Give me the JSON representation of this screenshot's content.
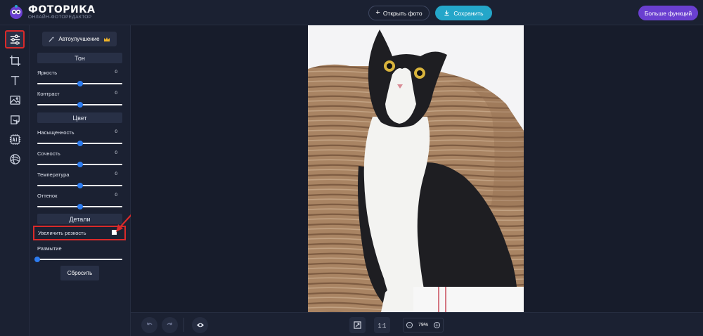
{
  "header": {
    "brand_title": "ФОТОРИКА",
    "brand_subtitle": "ОНЛАЙН-ФОТОРЕДАКТОР",
    "open_photo_label": "Открыть фото",
    "save_label": "Сохранить",
    "more_features_label": "Больше функций"
  },
  "tool_rail": {
    "items": [
      {
        "icon": "sliders-icon",
        "active": true
      },
      {
        "icon": "crop-icon"
      },
      {
        "icon": "text-icon"
      },
      {
        "icon": "image-icon"
      },
      {
        "icon": "sticker-icon"
      },
      {
        "icon": "ai-icon"
      },
      {
        "icon": "palette-icon"
      }
    ]
  },
  "panel": {
    "auto_enhance_label": "Автоулучшение",
    "sections": {
      "tone": "Тон",
      "color": "Цвет",
      "details": "Детали"
    },
    "sliders": {
      "brightness": {
        "label": "Яркость",
        "value": "0",
        "level": 0.5
      },
      "contrast": {
        "label": "Контраст",
        "value": "0",
        "level": 0.5
      },
      "saturation": {
        "label": "Насыщенность",
        "value": "0",
        "level": 0.5
      },
      "vibrance": {
        "label": "Сочность",
        "value": "0",
        "level": 0.5
      },
      "temperature": {
        "label": "Температура",
        "value": "0",
        "level": 0.5
      },
      "tint": {
        "label": "Оттенок",
        "value": "0",
        "level": 0.5
      },
      "blur": {
        "label": "Размытие",
        "level": 0
      }
    },
    "sharpen_label": "Увеличить резкость",
    "sharpen_checked": false,
    "reset_label": "Сбросить"
  },
  "bottom_bar": {
    "actual_size_label": "1:1",
    "zoom_level": "79%"
  },
  "colors": {
    "accent_save": "#24a6c9",
    "accent_more": "#6a3fd0",
    "slider_thumb": "#2d7cf0",
    "highlight": "#d92a2a"
  }
}
